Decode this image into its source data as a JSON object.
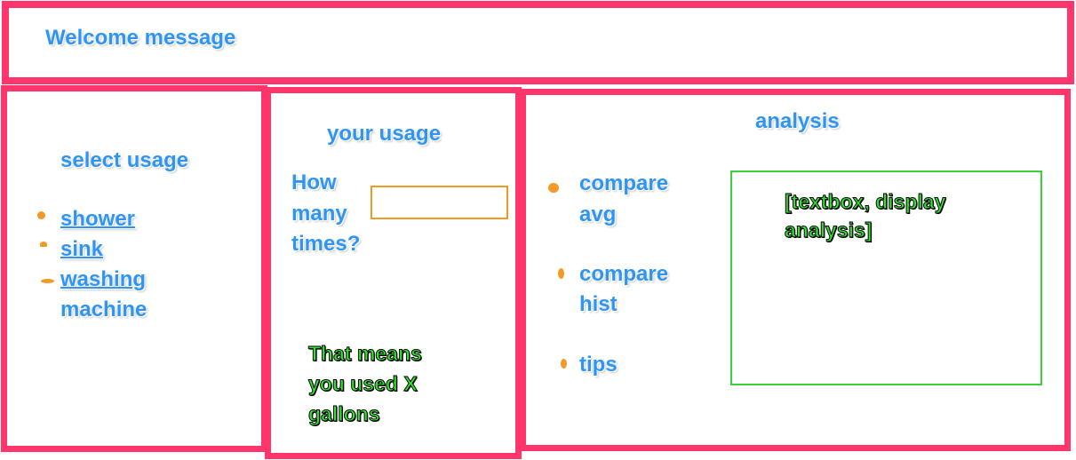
{
  "header": {
    "welcome": "Welcome message"
  },
  "select_panel": {
    "title": "select usage",
    "options": [
      {
        "label": "shower"
      },
      {
        "label": "sink"
      },
      {
        "label": "washing machine",
        "line1": "washing",
        "line2": "machine"
      }
    ]
  },
  "usage_panel": {
    "title": "your usage",
    "question_line1": "How",
    "question_line2": "many",
    "question_line3": "times?",
    "input_value": "",
    "result_line1": "That means",
    "result_line2": "you used X",
    "result_line3": "gallons"
  },
  "analysis_panel": {
    "title": "analysis",
    "options": [
      {
        "line1": "compare",
        "line2": "avg"
      },
      {
        "line1": "compare",
        "line2": "hist"
      },
      {
        "line1": "tips"
      }
    ],
    "textbox_line1": "[textbox, display",
    "textbox_line2": "analysis]"
  },
  "colors": {
    "panel_border": "#ff356c",
    "blue_text": "#2f95f3",
    "orange": "#f39a26",
    "green": "#31e52c"
  }
}
